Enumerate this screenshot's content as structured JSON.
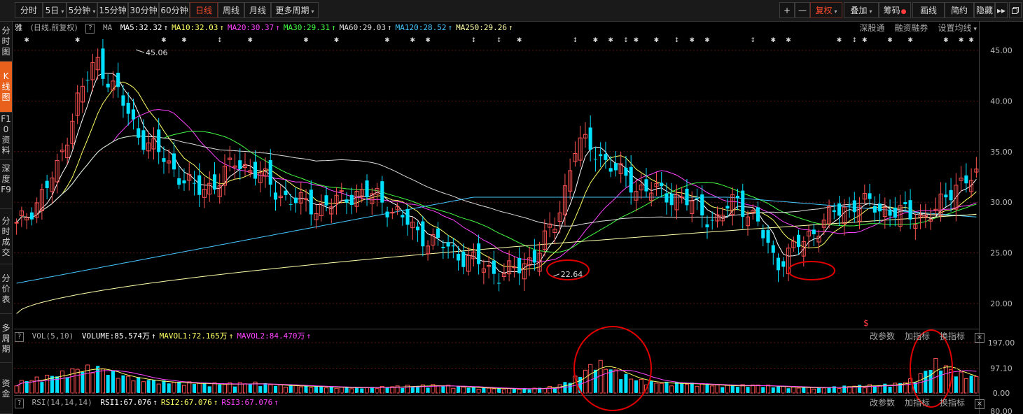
{
  "toolbar": {
    "periods": [
      "分时",
      "5日",
      "5分钟",
      "15分钟",
      "30分钟",
      "60分钟",
      "日线",
      "周线",
      "月线",
      "更多周期"
    ],
    "active_period": "日线",
    "right_buttons": [
      "+",
      "—",
      "复权",
      "叠加",
      "筹码",
      "画线",
      "简约",
      "隐藏"
    ],
    "more_arrow": "▸▸",
    "restore_icon": "restore-window-icon",
    "accent_color": "#ff4b2b"
  },
  "sidebar": {
    "items": [
      "分时图",
      "K线图",
      "F10资料",
      "深度F9",
      "分时成交",
      "分价表",
      "多周期",
      "资金"
    ],
    "active": "K线图",
    "active_color": "#e8601c"
  },
  "header": {
    "stock_name": "雅",
    "period_label": "(日线,前复权)",
    "ma_label": "MA",
    "ma": [
      {
        "name": "MA5",
        "value": "32.32",
        "color": "#ffffff"
      },
      {
        "name": "MA10",
        "value": "32.03",
        "color": "#ffff66"
      },
      {
        "name": "MA20",
        "value": "30.37",
        "color": "#ff44ff"
      },
      {
        "name": "MA30",
        "value": "29.31",
        "color": "#44ff44"
      },
      {
        "name": "MA60",
        "value": "29.03",
        "color": "#dddddd"
      },
      {
        "name": "MA120",
        "value": "28.52",
        "color": "#44c8ff"
      },
      {
        "name": "MA250",
        "value": "29.26",
        "color": "#ffffaa"
      }
    ],
    "links": [
      "深股通",
      "融资融券",
      "设置均线"
    ]
  },
  "price_axis": {
    "ticks": [
      "45.00",
      "40.00",
      "35.00",
      "30.00",
      "25.00",
      "20.00"
    ]
  },
  "annotations": {
    "high": "45.06",
    "low": "22.64",
    "dollar": "$"
  },
  "volume": {
    "title": "VOL(5,10)",
    "items": [
      {
        "name": "VOLUME",
        "value": "85.574万",
        "color": "#ffffff"
      },
      {
        "name": "MAVOL1",
        "value": "72.165万",
        "color": "#ffff66"
      },
      {
        "name": "MAVOL2",
        "value": "84.470万",
        "color": "#ff44ff"
      }
    ],
    "ticks": [
      "197.00",
      "97.10",
      "0.00"
    ],
    "links": [
      "改参数",
      "加指标",
      "换指标"
    ]
  },
  "rsi": {
    "title": "RSI(14,14,14)",
    "items": [
      {
        "name": "RSI1",
        "value": "67.076",
        "color": "#ffffff"
      },
      {
        "name": "RSI2",
        "value": "67.076",
        "color": "#ffff66"
      },
      {
        "name": "RSI3",
        "value": "67.076",
        "color": "#ff44ff"
      }
    ],
    "ticks": [
      "80.00"
    ],
    "links": [
      "改参数",
      "加指标",
      "换指标"
    ]
  },
  "colors": {
    "up": "#ff5252",
    "down": "#00e0ff",
    "grid": "#5a1414",
    "axis_text": "#bbbbbb",
    "highlight_circle": "#e00000"
  },
  "chart_data": [
    {
      "type": "candlestick",
      "title": "",
      "ylim": [
        18,
        46
      ],
      "y_ticks": [
        45,
        40,
        35,
        30,
        25,
        20
      ],
      "high": 45.06,
      "low": 22.64,
      "close_path": [
        27.5,
        30,
        33,
        40,
        44,
        41,
        37,
        35,
        33,
        31,
        32,
        34,
        33,
        31,
        30,
        29.5,
        30,
        31,
        30.5,
        29,
        27,
        26,
        25,
        24,
        23,
        23.2,
        25,
        28,
        36,
        35,
        33,
        31.5,
        31,
        30.5,
        29.5,
        28,
        30.5,
        28,
        24,
        25.5,
        27.5,
        29,
        30,
        29.5,
        29,
        28.5,
        29,
        32,
        32.3
      ]
    },
    {
      "type": "bar",
      "title": "VOL(5,10)",
      "ylim": [
        0,
        197
      ],
      "y_ticks": [
        197,
        97.1,
        0
      ],
      "levels": [
        40,
        55,
        70,
        90,
        100,
        70,
        55,
        45,
        40,
        38,
        35,
        36,
        38,
        30,
        28,
        25,
        22,
        20,
        22,
        25,
        28,
        30,
        25,
        20,
        18,
        16,
        18,
        25,
        60,
        120,
        80,
        50,
        40,
        38,
        35,
        30,
        28,
        30,
        25,
        22,
        20,
        24,
        28,
        30,
        35,
        55,
        120,
        75,
        60
      ]
    }
  ]
}
